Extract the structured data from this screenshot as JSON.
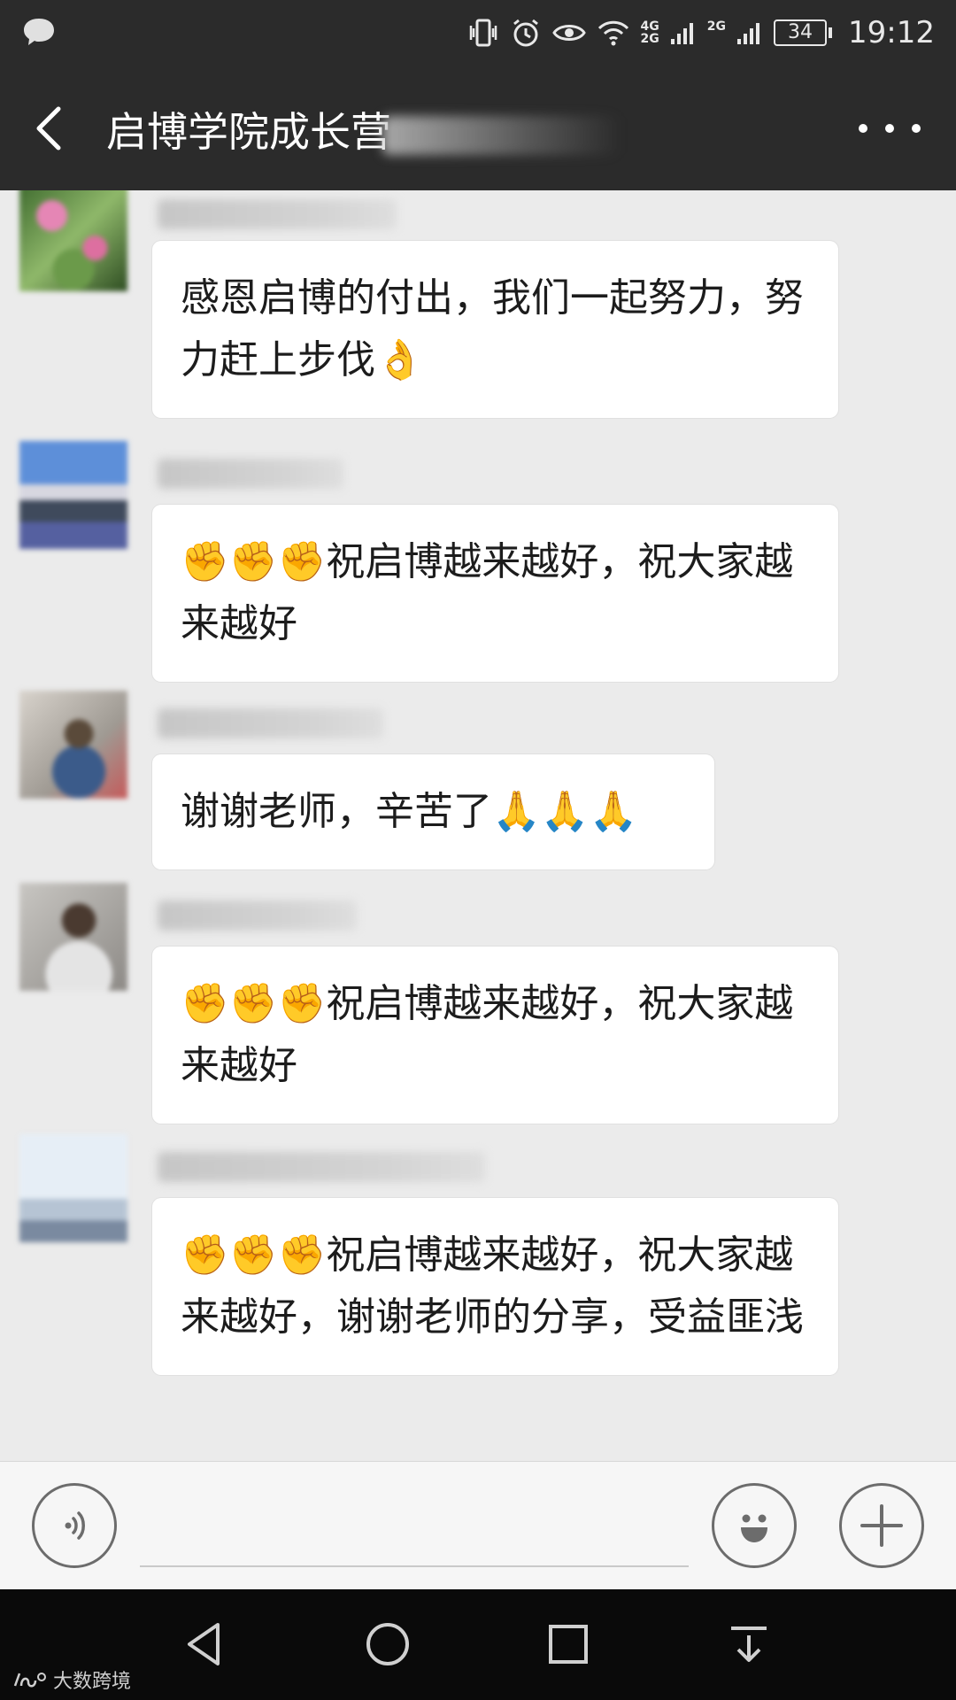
{
  "status_bar": {
    "network_top": "4G",
    "network_bottom": "2G",
    "network2": "2G",
    "battery": "34",
    "time": "19:12"
  },
  "header": {
    "title": "启博学院成长营",
    "back_icon": "back-arrow-icon",
    "more_icon": "more-dots-icon"
  },
  "messages": [
    {
      "text": "感恩启博的付出，我们一起努力，努力赶上步伐👌"
    },
    {
      "text": "✊✊✊祝启博越来越好，祝大家越来越好"
    },
    {
      "text": "谢谢老师，辛苦了🙏🙏🙏"
    },
    {
      "text": "✊✊✊祝启博越来越好，祝大家越来越好"
    },
    {
      "text": "✊✊✊祝启博越来越好，祝大家越来越好，谢谢老师的分享，受益匪浅"
    }
  ],
  "input_bar": {
    "voice_icon": "voice-icon",
    "emoji_icon": "emoji-icon",
    "plus_icon": "plus-icon"
  },
  "nav_bar": {
    "back": "back-triangle-icon",
    "home": "home-circle-icon",
    "recents": "recents-square-icon",
    "notifications": "notification-pulldown-icon"
  },
  "watermark": "大数跨境"
}
